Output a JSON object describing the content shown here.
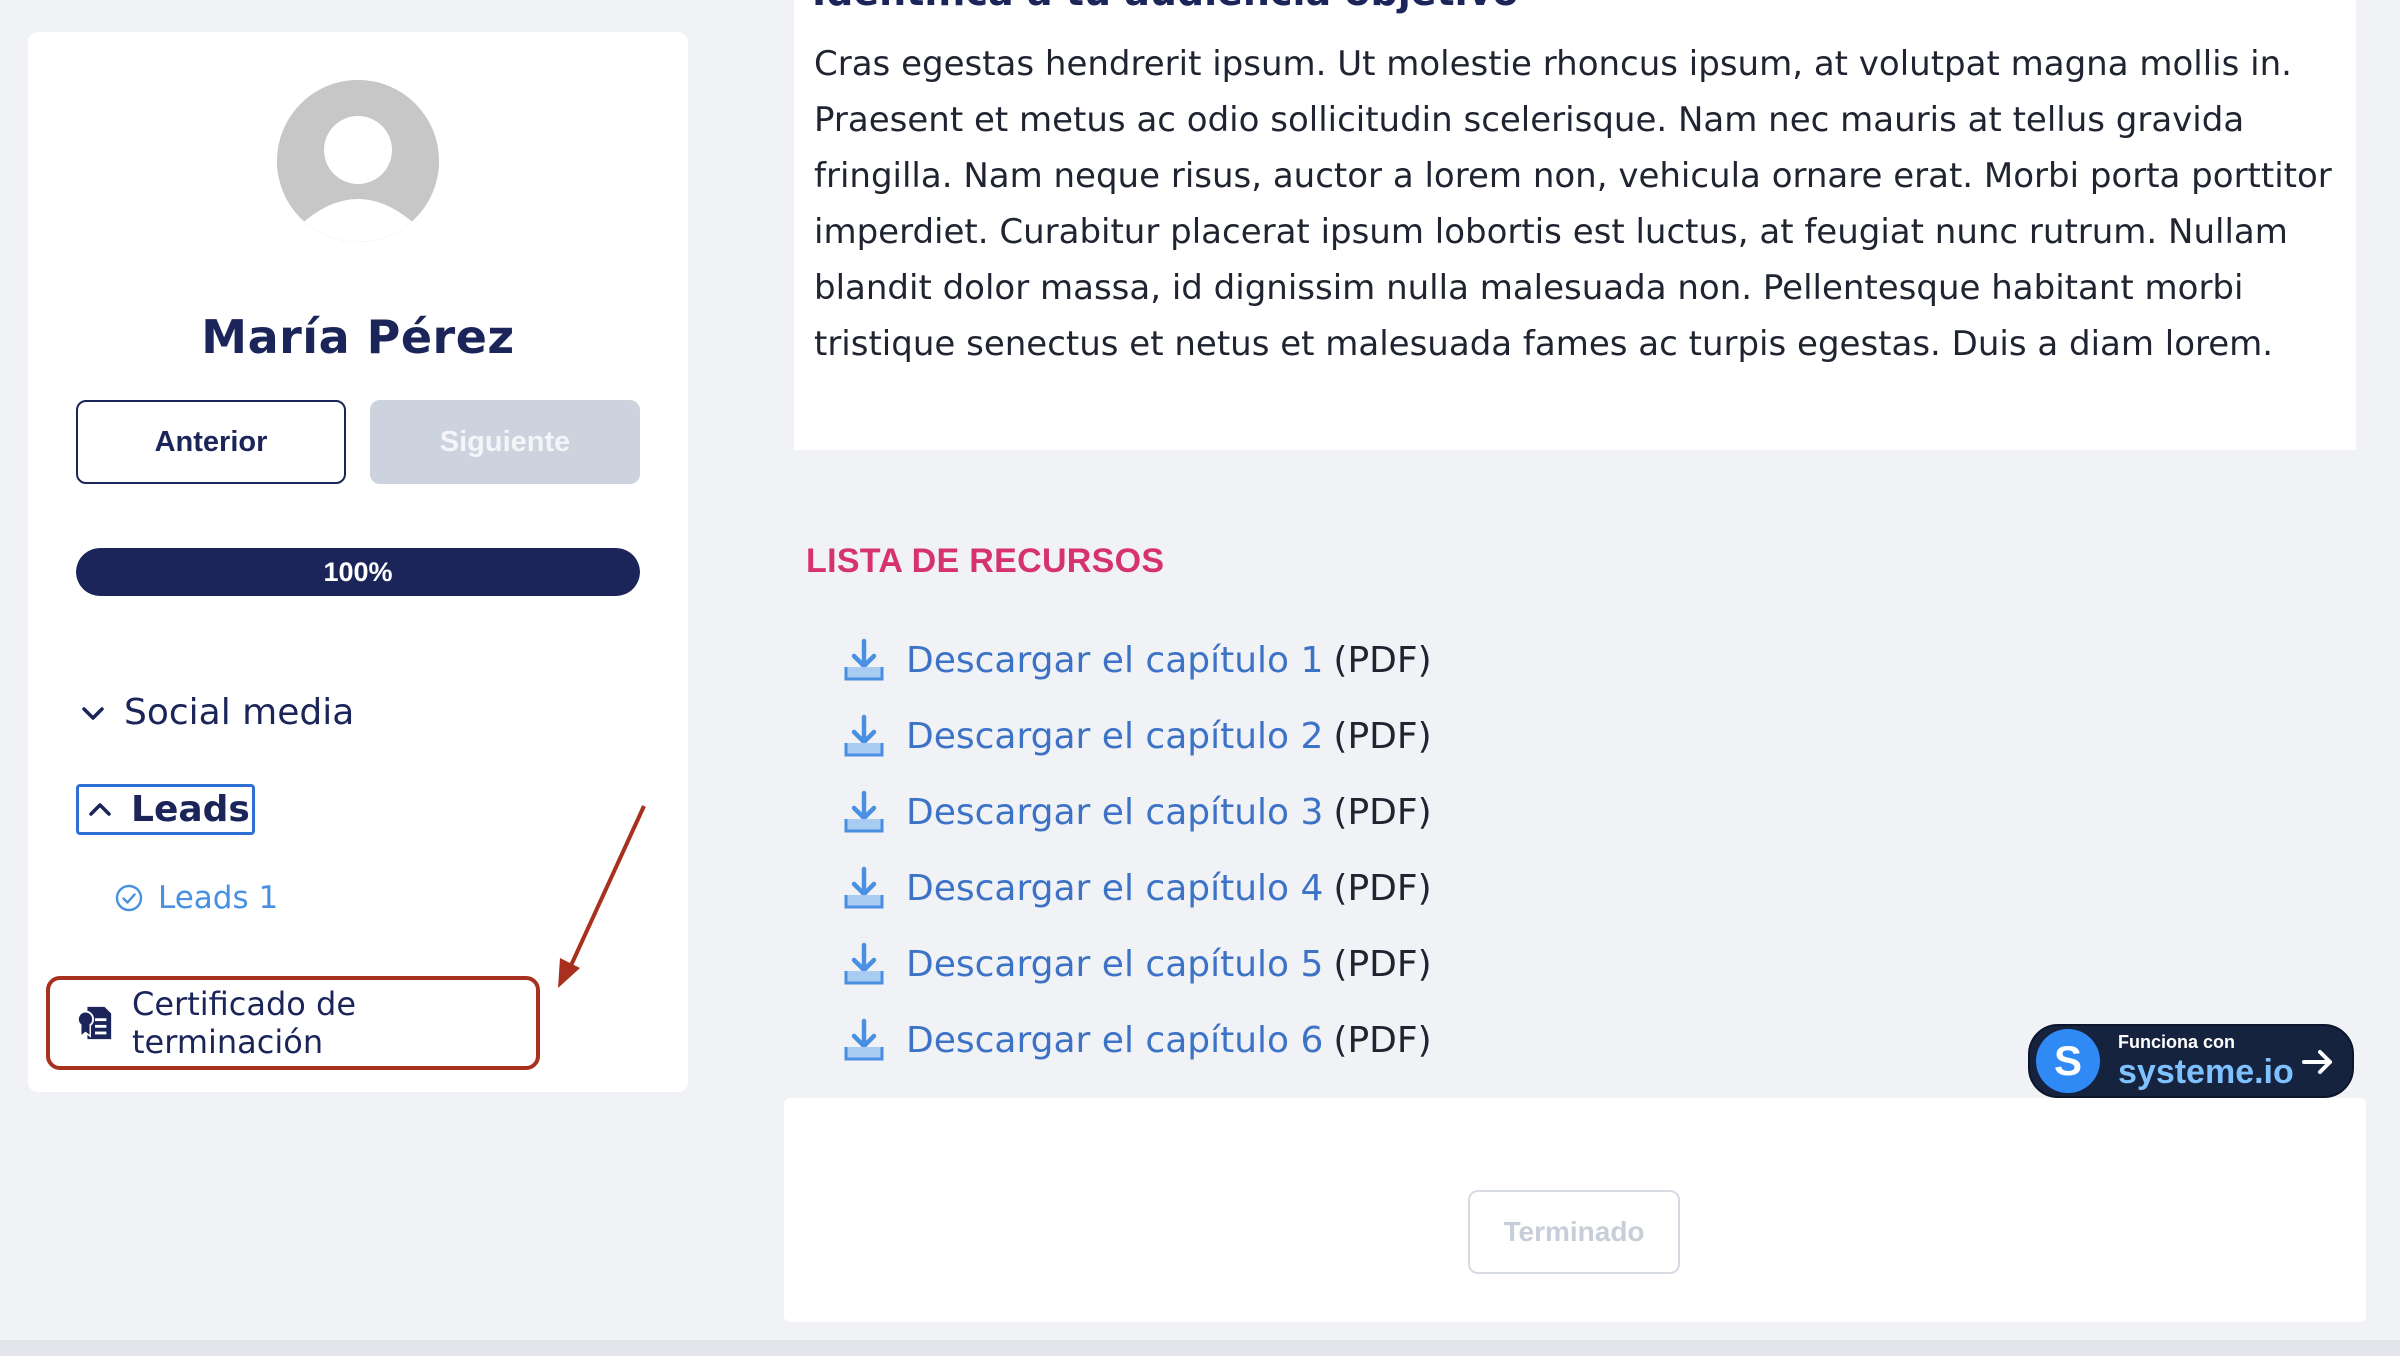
{
  "sidebar": {
    "user_name": "María Pérez",
    "prev_label": "Anterior",
    "next_label": "Siguiente",
    "progress_value": 100,
    "progress_label": "100%",
    "modules": [
      {
        "label": "Social media",
        "expanded": false
      },
      {
        "label": "Leads",
        "expanded": true
      }
    ],
    "lessons": [
      {
        "label": "Leads 1",
        "completed": true
      }
    ],
    "certificate_label": "Certificado de terminación"
  },
  "main": {
    "section_heading": "Identifica a tu audiencia objetivo",
    "body_text": "Cras egestas hendrerit ipsum. Ut molestie rhoncus ipsum, at volutpat magna mollis in. Praesent et metus ac odio sollicitudin scelerisque. Nam nec mauris at tellus gravida fringilla. Nam neque risus, auctor a lorem non, vehicula ornare erat. Morbi porta porttitor imperdiet. Curabitur placerat ipsum lobortis est luctus, at feugiat nunc rutrum. Nullam blandit dolor massa, id dignissim nulla malesuada non. Pellentesque habitant morbi tristique senectus et netus et malesuada fames ac turpis egestas. Duis a diam lorem.",
    "resources_title": "LISTA DE RECURSOS",
    "resources": [
      {
        "link": "Descargar el capítulo 1",
        "suffix": "(PDF)"
      },
      {
        "link": "Descargar el capítulo 2",
        "suffix": "(PDF)"
      },
      {
        "link": "Descargar el capítulo 3",
        "suffix": "(PDF)"
      },
      {
        "link": "Descargar el capítulo 4",
        "suffix": "(PDF)"
      },
      {
        "link": "Descargar el capítulo 5",
        "suffix": "(PDF)"
      },
      {
        "link": "Descargar el capítulo 6",
        "suffix": "(PDF)"
      }
    ],
    "done_label": "Terminado"
  },
  "badge": {
    "small_text": "Funciona con",
    "brand": "systeme.io",
    "logo_letter": "S"
  },
  "colors": {
    "navy": "#1b2559",
    "accent_pink": "#d6336c",
    "link_blue": "#3d73c7",
    "annotation_red": "#a7301f"
  }
}
